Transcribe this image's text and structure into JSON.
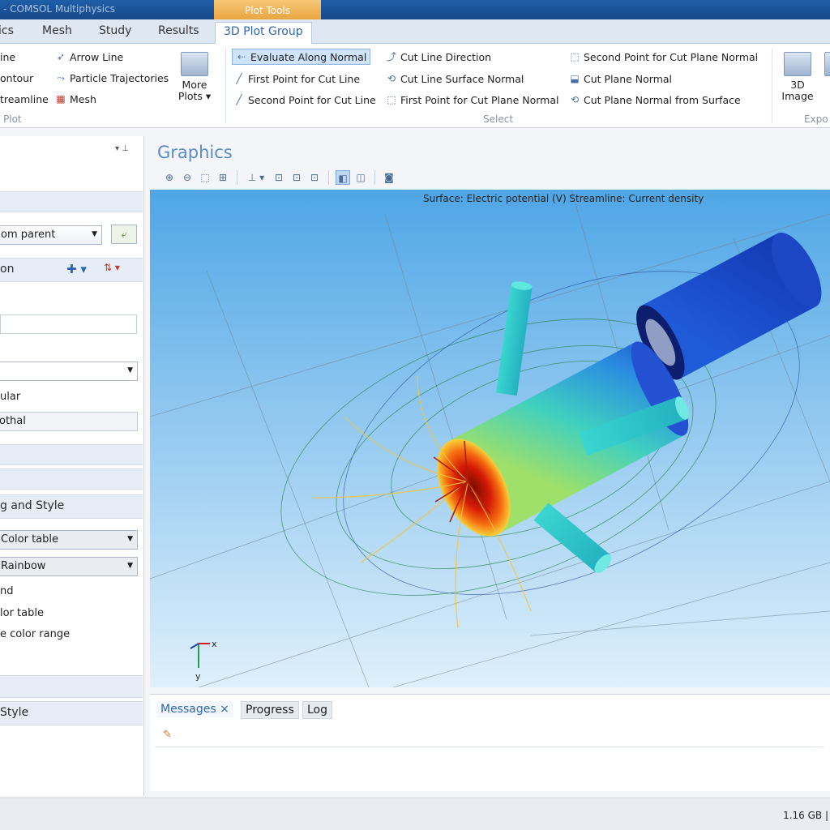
{
  "titlebar": {
    "text": "- COMSOL Multiphysics",
    "context_tab": "Plot Tools"
  },
  "tabs": [
    "ics",
    "Mesh",
    "Study",
    "Results",
    "3D Plot Group"
  ],
  "ribbon": {
    "plot_items": [
      "ine",
      "ontour",
      "treamline"
    ],
    "plot_items2": [
      "Arrow Line",
      "Particle Trajectories",
      "Mesh"
    ],
    "more_plots": [
      "More",
      "Plots ▾"
    ],
    "plot_caption": "Plot",
    "select_col1": [
      "Evaluate Along Normal",
      "First Point for Cut Line",
      "Second Point for Cut Line"
    ],
    "select_col2": [
      "Cut Line Direction",
      "Cut Line Surface Normal",
      "First Point for Cut Plane Normal"
    ],
    "select_col3": [
      "Second Point for Cut Plane Normal",
      "Cut Plane Normal",
      "Cut Plane Normal from Surface"
    ],
    "select_caption": "Select",
    "image_btn": [
      "3D",
      "Image"
    ],
    "export_caption": "Expo"
  },
  "left": {
    "parent_combo": "om parent",
    "section_label": "on",
    "coloring_header": "g and Style",
    "color_type": "Color table",
    "color_table": "Rainbow",
    "labels": [
      "nd",
      "lor table",
      "e color range"
    ],
    "text1": "ular",
    "text2": "othal",
    "bottom_section": "Style"
  },
  "graphics": {
    "title": "Graphics",
    "caption": "Surface: Electric potential (V)  Streamline: Current density",
    "axis_x": "x",
    "axis_y": "y"
  },
  "messages": {
    "tabs": [
      "Messages ×",
      "Progress",
      "Log"
    ]
  },
  "status": {
    "memory": "1.16 GB |"
  },
  "colors": {
    "accent": "#2e67b1",
    "ribbon_tab": "#e9a23b",
    "viewport_top": "#4fa6e6",
    "viewport_bottom": "#dff0fb"
  }
}
